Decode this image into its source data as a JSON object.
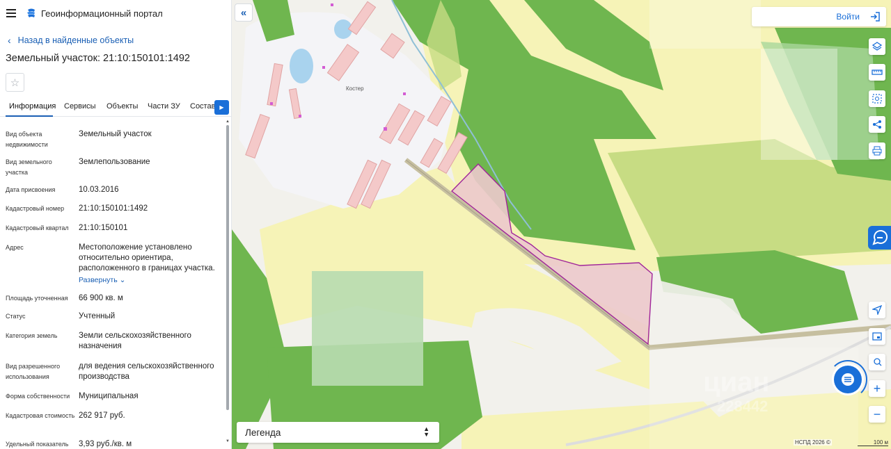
{
  "app": {
    "title": "Геоинформационный портал"
  },
  "panel": {
    "back_label": "Назад в найденные объекты",
    "object_title": "Земельный участок: 21:10:150101:1492",
    "tabs": [
      {
        "label": "Информация",
        "active": true
      },
      {
        "label": "Сервисы",
        "active": false
      },
      {
        "label": "Объекты",
        "active": false
      },
      {
        "label": "Части ЗУ",
        "active": false
      },
      {
        "label": "Состав",
        "active": false
      }
    ],
    "properties": [
      {
        "label": "Вид объекта недвижимости",
        "value": "Земельный участок"
      },
      {
        "label": "Вид земельного участка",
        "value": "Землепользование"
      },
      {
        "label": "Дата присвоения",
        "value": "10.03.2016"
      },
      {
        "label": "Кадастровый номер",
        "value": "21:10:150101:1492"
      },
      {
        "label": "Кадастровый квартал",
        "value": "21:10:150101"
      },
      {
        "label": "Адрес",
        "value": "Местоположение установлено относительно ориентира, расположенного в границах участка."
      },
      {
        "label": "Площадь уточненная",
        "value": "66 900 кв. м"
      },
      {
        "label": "Статус",
        "value": "Учтенный"
      },
      {
        "label": "Категория земель",
        "value": "Земли сельскохозяйственного назначения"
      },
      {
        "label": "Вид разрешенного использования",
        "value": "для ведения сельскохозяйственного производства"
      },
      {
        "label": "Форма собственности",
        "value": "Муниципальная"
      },
      {
        "label": "Кадастровая стоимость",
        "value": "262 917 руб."
      },
      {
        "label": "Удельный показатель",
        "value": "3,93 руб./кв. м"
      }
    ],
    "expand_label": "Развернуть"
  },
  "map": {
    "login_label": "Войти",
    "legend_label": "Легенда",
    "place_label": "Костер",
    "copyright": "НСПД 2026 ©",
    "scale_label": "100 м",
    "watermark": "циан",
    "watermark_number": "228442",
    "colors": {
      "forest": "#6fb64f",
      "field": "#f6f3b7",
      "meadow": "#c7dc83",
      "parcel_fill": "#ecc9cc",
      "parcel_stroke": "#a0259a",
      "building": "#f4c9c9",
      "accent": "#1a6fd8"
    }
  }
}
